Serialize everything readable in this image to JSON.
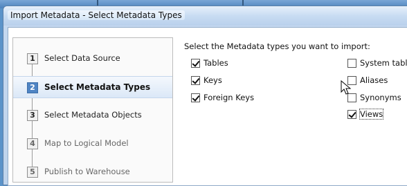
{
  "window": {
    "title": "Import Metadata - Select Metadata Types"
  },
  "wizard": {
    "steps": [
      {
        "number": "1",
        "label": "Select Data Source",
        "state": "normal"
      },
      {
        "number": "2",
        "label": "Select Metadata Types",
        "state": "active"
      },
      {
        "number": "3",
        "label": "Select Metadata Objects",
        "state": "normal"
      },
      {
        "number": "4",
        "label": "Map to Logical Model",
        "state": "disabled"
      },
      {
        "number": "5",
        "label": "Publish to Warehouse",
        "state": "disabled"
      }
    ]
  },
  "panel": {
    "heading": "Select the Metadata types you want to import:",
    "left_options": [
      {
        "label": "Tables",
        "checked": true
      },
      {
        "label": "Keys",
        "checked": true
      },
      {
        "label": "Foreign Keys",
        "checked": true
      }
    ],
    "right_options": [
      {
        "label": "System table",
        "checked": false
      },
      {
        "label": "Aliases",
        "checked": false
      },
      {
        "label": "Synonyms",
        "checked": false
      },
      {
        "label": "Views",
        "checked": true
      }
    ]
  },
  "icons": {
    "cursor": "mouse-pointer-icon"
  }
}
